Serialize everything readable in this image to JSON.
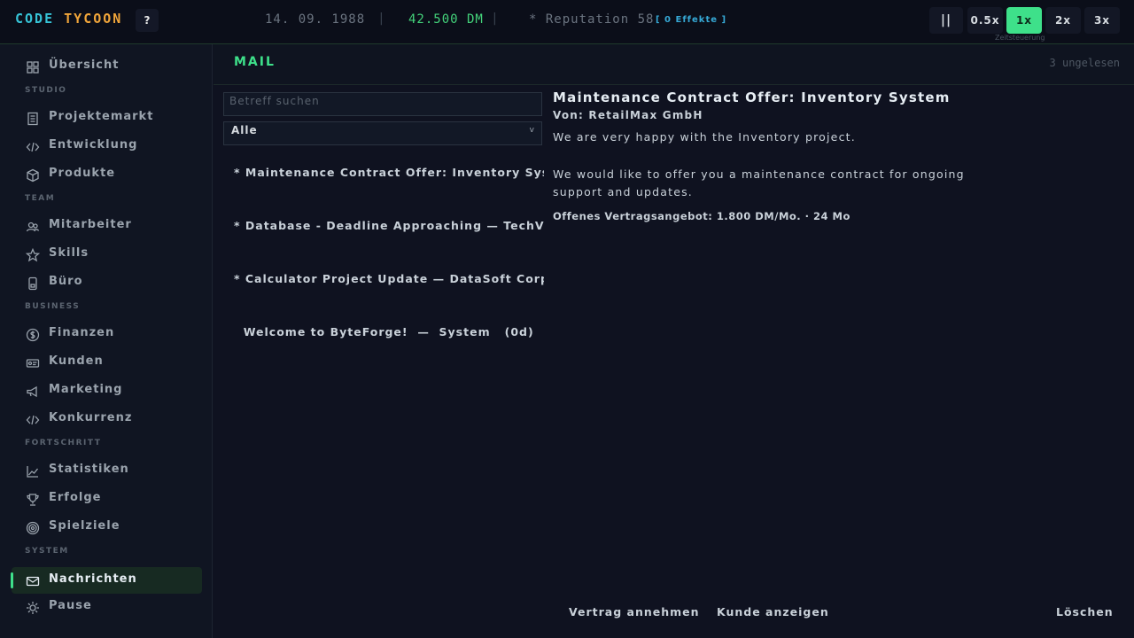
{
  "topbar": {
    "logo_a": "CODE",
    "logo_b": "TYCOON",
    "help_label": "?",
    "date": "14. 09. 1988",
    "money": "42.500 DM",
    "reputation": "* Reputation 58",
    "effects": "[ 0 Effekte ]",
    "separator": "|",
    "pause_label": "||",
    "speeds": [
      "0.5x",
      "1x",
      "2x",
      "3x"
    ],
    "active_speed": "1x",
    "speed_caption": "Zeitsteuerung"
  },
  "sidebar": {
    "items": [
      {
        "label": "Übersicht",
        "icon": "dashboard-icon"
      },
      {
        "section": "STUDIO"
      },
      {
        "label": "Projektemarkt",
        "icon": "document-icon"
      },
      {
        "label": "Entwicklung",
        "icon": "code-icon"
      },
      {
        "label": "Produkte",
        "icon": "box-icon"
      },
      {
        "section": "TEAM"
      },
      {
        "label": "Mitarbeiter",
        "icon": "people-icon"
      },
      {
        "label": "Skills",
        "icon": "star-icon"
      },
      {
        "label": "Büro",
        "icon": "office-icon"
      },
      {
        "section": "BUSINESS"
      },
      {
        "label": "Finanzen",
        "icon": "coin-icon"
      },
      {
        "label": "Kunden",
        "icon": "id-card-icon"
      },
      {
        "label": "Marketing",
        "icon": "megaphone-icon"
      },
      {
        "label": "Konkurrenz",
        "icon": "code-icon"
      },
      {
        "section": "FORTSCHRITT"
      },
      {
        "label": "Statistiken",
        "icon": "chart-icon"
      },
      {
        "label": "Erfolge",
        "icon": "trophy-icon"
      },
      {
        "label": "Spielziele",
        "icon": "target-icon"
      },
      {
        "section": "SYSTEM"
      },
      {
        "label": "Nachrichten",
        "icon": "mail-icon",
        "active": true
      },
      {
        "label": "Pause",
        "icon": "gear-icon"
      }
    ]
  },
  "main": {
    "title": "MAIL",
    "unread": "3 ungelesen",
    "search_placeholder": "Betreff suchen",
    "filter_value": "Alle",
    "filter_chevron": "v",
    "mails": [
      {
        "text": "* Maintenance Contract Offer: Inventory System"
      },
      {
        "text": "* Database - Deadline Approaching  —  TechVault Inc."
      },
      {
        "text": "* Calculator Project Update  —  DataSoft Corp."
      },
      {
        "text": "  Welcome to ByteForge!  —  System   (0d)"
      }
    ],
    "detail": {
      "title": "Maintenance Contract Offer: Inventory System",
      "from": "Von:  RetailMax GmbH",
      "body1": "We are very happy with the Inventory project.",
      "body2": "We would like to offer you a maintenance contract for ongoing support and updates.",
      "offer": "Offenes Vertragsangebot: 1.800 DM/Mo. · 24 Mo"
    },
    "actions": {
      "accept": "Vertrag annehmen",
      "show_client": "Kunde anzeigen",
      "delete": "Löschen"
    }
  }
}
